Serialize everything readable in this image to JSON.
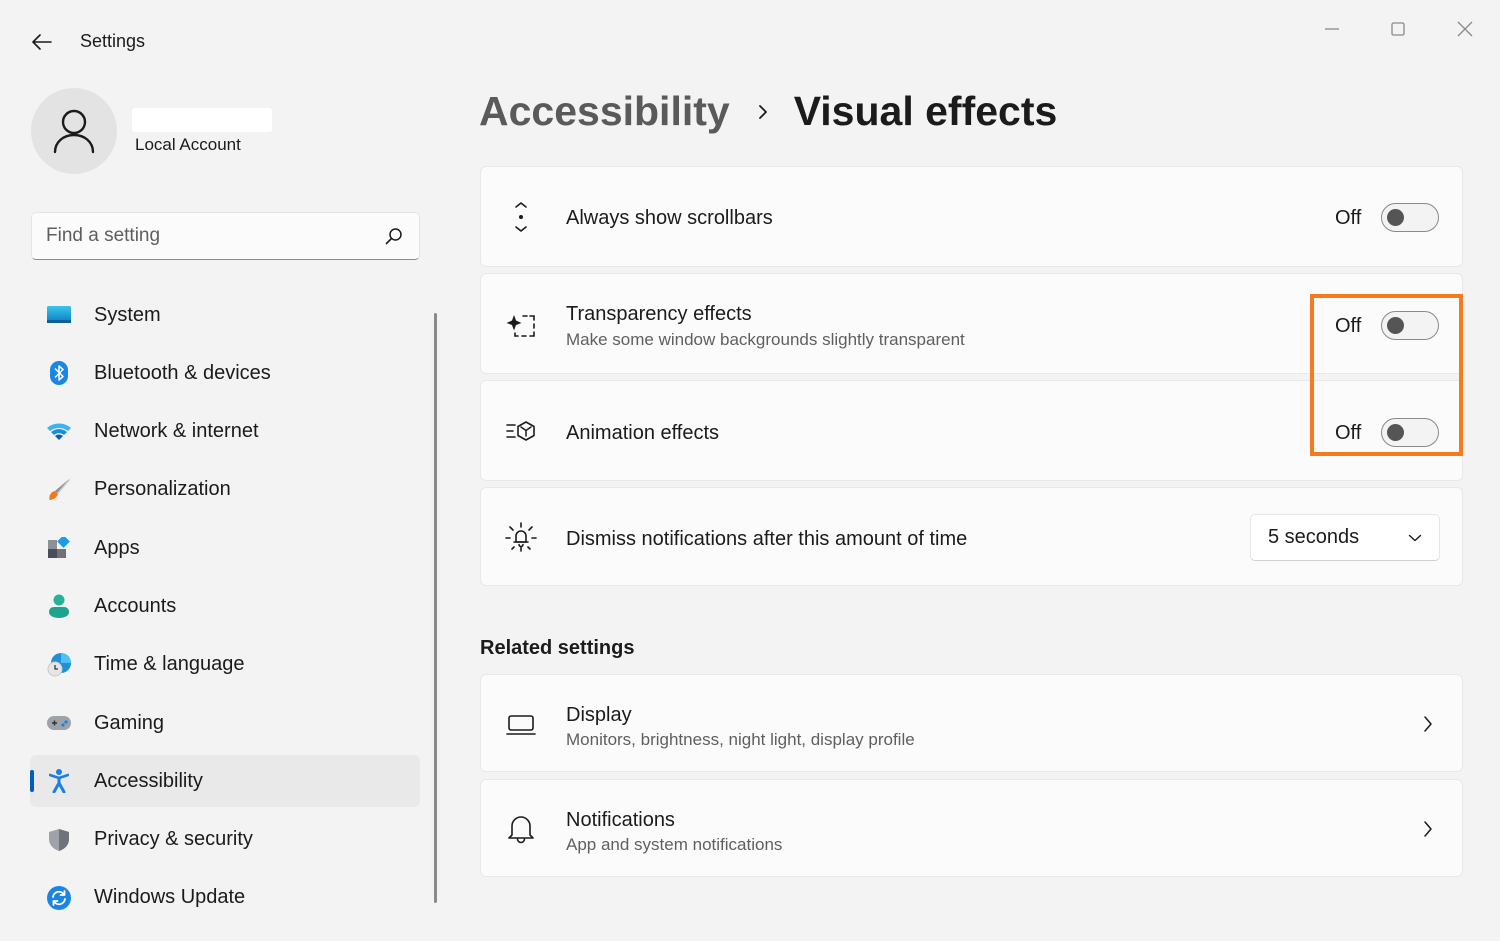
{
  "window": {
    "title": "Settings",
    "controls": {
      "minimize": "minimize-icon",
      "maximize": "maximize-icon",
      "close": "close-icon"
    }
  },
  "profile": {
    "name": "",
    "account_type": "Local Account"
  },
  "search": {
    "placeholder": "Find a setting",
    "value": ""
  },
  "sidebar": {
    "items": [
      {
        "label": "System",
        "icon": "system-display-icon",
        "selected": false
      },
      {
        "label": "Bluetooth & devices",
        "icon": "bluetooth-icon",
        "selected": false
      },
      {
        "label": "Network & internet",
        "icon": "wifi-icon",
        "selected": false
      },
      {
        "label": "Personalization",
        "icon": "paintbrush-icon",
        "selected": false
      },
      {
        "label": "Apps",
        "icon": "apps-icon",
        "selected": false
      },
      {
        "label": "Accounts",
        "icon": "accounts-person-icon",
        "selected": false
      },
      {
        "label": "Time & language",
        "icon": "globe-clock-icon",
        "selected": false
      },
      {
        "label": "Gaming",
        "icon": "gamepad-icon",
        "selected": false
      },
      {
        "label": "Accessibility",
        "icon": "accessibility-icon",
        "selected": true
      },
      {
        "label": "Privacy & security",
        "icon": "shield-icon",
        "selected": false
      },
      {
        "label": "Windows Update",
        "icon": "update-sync-icon",
        "selected": false
      }
    ]
  },
  "header": {
    "breadcrumb_parent": "Accessibility",
    "breadcrumb_separator": "chevron-right-icon",
    "title": "Visual effects"
  },
  "settings": [
    {
      "title": "Always show scrollbars",
      "subtitle": "",
      "icon": "scrollbar-arrows-icon",
      "control": "toggle",
      "state_label": "Off",
      "on": false
    },
    {
      "title": "Transparency effects",
      "subtitle": "Make some window backgrounds slightly transparent",
      "icon": "transparency-sparkle-icon",
      "control": "toggle",
      "state_label": "Off",
      "on": false
    },
    {
      "title": "Animation effects",
      "subtitle": "",
      "icon": "animation-cube-icon",
      "control": "toggle",
      "state_label": "Off",
      "on": false
    },
    {
      "title": "Dismiss notifications after this amount of time",
      "subtitle": "",
      "icon": "notification-timer-icon",
      "control": "dropdown",
      "selected": "5 seconds"
    }
  ],
  "related": {
    "heading": "Related settings",
    "items": [
      {
        "title": "Display",
        "subtitle": "Monitors, brightness, night light, display profile",
        "icon": "laptop-display-icon"
      },
      {
        "title": "Notifications",
        "subtitle": "App and system notifications",
        "icon": "bell-icon"
      }
    ]
  },
  "annotation": {
    "highlight_color": "#f47b20",
    "highlights": "transparency and animation toggles"
  },
  "colors": {
    "accent": "#005fb8",
    "background": "#f3f3f3",
    "card": "#fbfbfb"
  }
}
